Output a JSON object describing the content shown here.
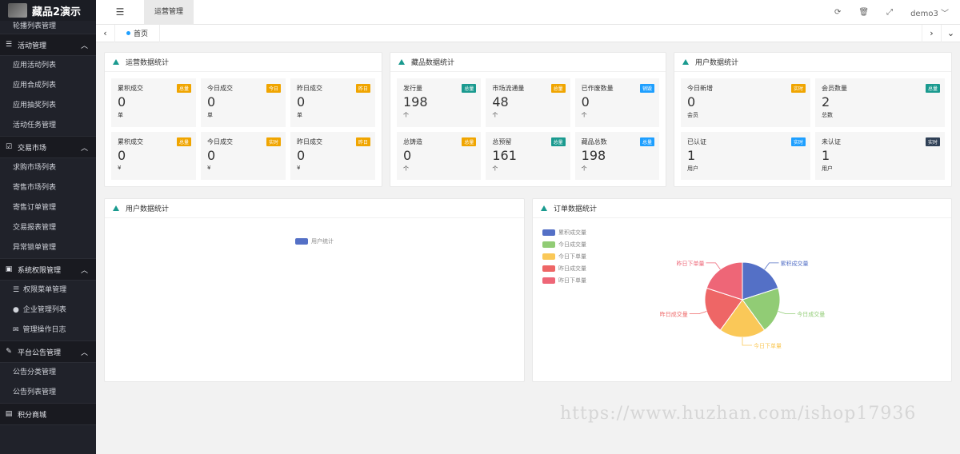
{
  "app": {
    "title": "藏品2演示"
  },
  "sidebar": {
    "top_item": "轮播列表管理",
    "groups": [
      {
        "label": "活动管理",
        "items": [
          "应用活动列表",
          "应用合成列表",
          "应用抽奖列表",
          "活动任务管理"
        ]
      },
      {
        "label": "交易市场",
        "items": [
          "求购市场列表",
          "寄售市场列表",
          "寄售订单管理",
          "交易报表管理",
          "异常锁单管理"
        ]
      },
      {
        "label": "系统权限管理",
        "items": [
          "权限菜单管理",
          "企业管理列表",
          "管理操作日志"
        ]
      },
      {
        "label": "平台公告管理",
        "items": [
          "公告分类管理",
          "公告列表管理"
        ]
      },
      {
        "label": "积分商城",
        "items": []
      }
    ]
  },
  "topbar": {
    "tab": "运营管理",
    "user": "demo3"
  },
  "tabs": {
    "home": "首页"
  },
  "panels": {
    "ops": {
      "title": "运营数据统计",
      "cards": [
        {
          "title": "累积成交",
          "badge": "总量",
          "badge_color": "#f0a500",
          "value": "0",
          "unit": "单"
        },
        {
          "title": "今日成交",
          "badge": "今日",
          "badge_color": "#f0a500",
          "value": "0",
          "unit": "单"
        },
        {
          "title": "昨日成交",
          "badge": "昨日",
          "badge_color": "#f0a500",
          "value": "0",
          "unit": "单"
        },
        {
          "title": "累积成交",
          "badge": "总量",
          "badge_color": "#f0a500",
          "value": "0",
          "unit": "¥"
        },
        {
          "title": "今日成交",
          "badge": "实时",
          "badge_color": "#f0a500",
          "value": "0",
          "unit": "¥"
        },
        {
          "title": "昨日成交",
          "badge": "昨日",
          "badge_color": "#f0a500",
          "value": "0",
          "unit": "¥"
        }
      ]
    },
    "collect": {
      "title": "藏品数据统计",
      "cards": [
        {
          "title": "发行量",
          "badge": "总量",
          "badge_color": "#1a9a8f",
          "value": "198",
          "unit": "个"
        },
        {
          "title": "市场流通量",
          "badge": "总量",
          "badge_color": "#f0a500",
          "value": "48",
          "unit": "个"
        },
        {
          "title": "已作废数量",
          "badge": "销毁",
          "badge_color": "#1e9fff",
          "value": "0",
          "unit": "个"
        },
        {
          "title": "总铸造",
          "badge": "总量",
          "badge_color": "#f0a500",
          "value": "0",
          "unit": "个"
        },
        {
          "title": "总预留",
          "badge": "总量",
          "badge_color": "#1a9a8f",
          "value": "161",
          "unit": "个"
        },
        {
          "title": "藏品总数",
          "badge": "总量",
          "badge_color": "#1e9fff",
          "value": "198",
          "unit": "个"
        }
      ]
    },
    "users": {
      "title": "用户数据统计",
      "cards": [
        {
          "title": "今日新增",
          "badge": "实时",
          "badge_color": "#f0a500",
          "value": "0",
          "unit": "会员"
        },
        {
          "title": "会员数量",
          "badge": "总量",
          "badge_color": "#1a9a8f",
          "value": "2",
          "unit": "总数"
        },
        {
          "title": "已认证",
          "badge": "实时",
          "badge_color": "#1e9fff",
          "value": "1",
          "unit": "用户"
        },
        {
          "title": "未认证",
          "badge": "实时",
          "badge_color": "#2f4056",
          "value": "1",
          "unit": "用户"
        }
      ]
    },
    "user_chart": {
      "title": "用户数据统计",
      "legend": "用户统计"
    },
    "order_chart": {
      "title": "订单数据统计"
    }
  },
  "chart_data": {
    "type": "pie",
    "title": "订单数据统计",
    "categories": [
      "累积成交量",
      "今日成交量",
      "今日下单量",
      "昨日成交量",
      "昨日下单量"
    ],
    "values": [
      1,
      1,
      1,
      1,
      1
    ],
    "colors": [
      "#5470c6",
      "#91cc75",
      "#fac858",
      "#ee6666",
      "#ee6677"
    ]
  },
  "watermark": "https://www.huzhan.com/ishop17936"
}
